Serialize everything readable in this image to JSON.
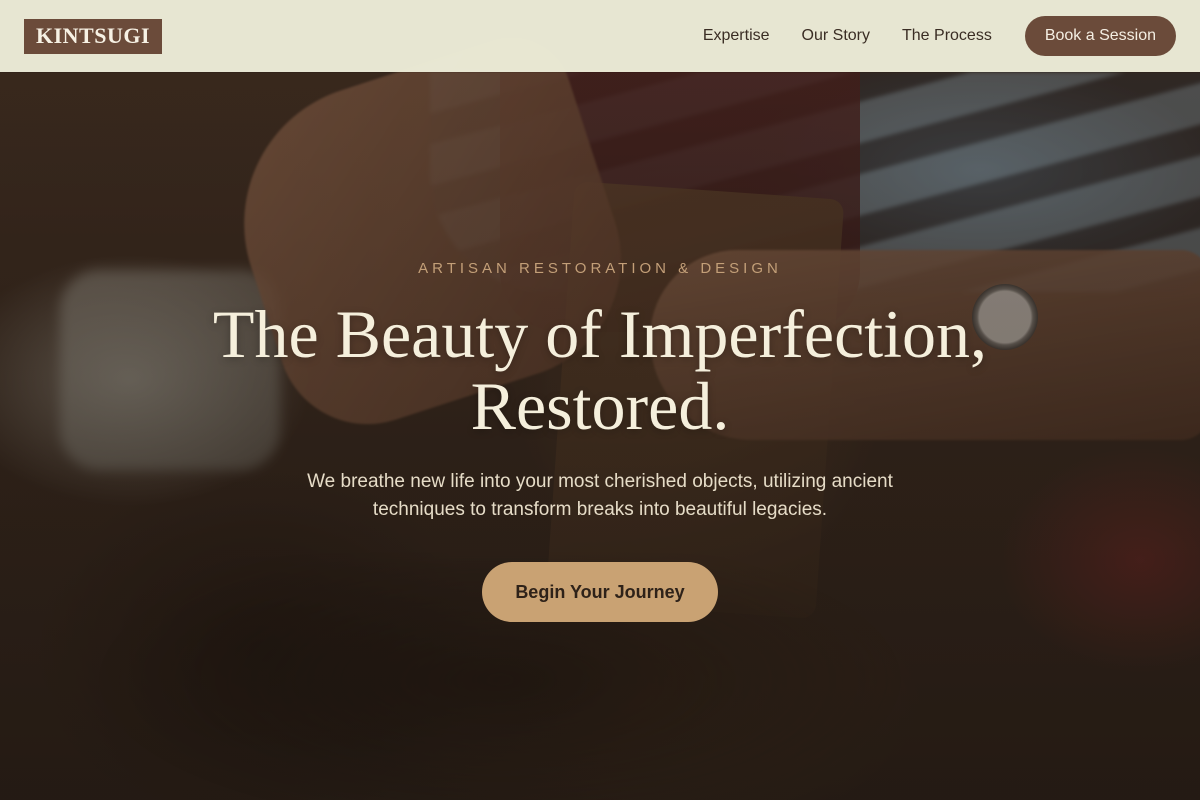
{
  "nav": {
    "logo": "KINTSUGI",
    "links": [
      "Expertise",
      "Our Story",
      "The Process"
    ],
    "cta": "Book a Session"
  },
  "hero": {
    "eyebrow": "ARTISAN RESTORATION & DESIGN",
    "headline_line1": "The Beauty of Imperfection,",
    "headline_line2": "Restored.",
    "subtext": "We breathe new life into your most cherished objects, utilizing ancient techniques to transform breaks into beautiful legacies.",
    "cta": "Begin Your Journey"
  },
  "colors": {
    "brand_brown": "#6b4b3a",
    "accent_gold": "#c9a273",
    "nav_background": "#eeeeda",
    "headline_cream": "#f5efdc"
  }
}
